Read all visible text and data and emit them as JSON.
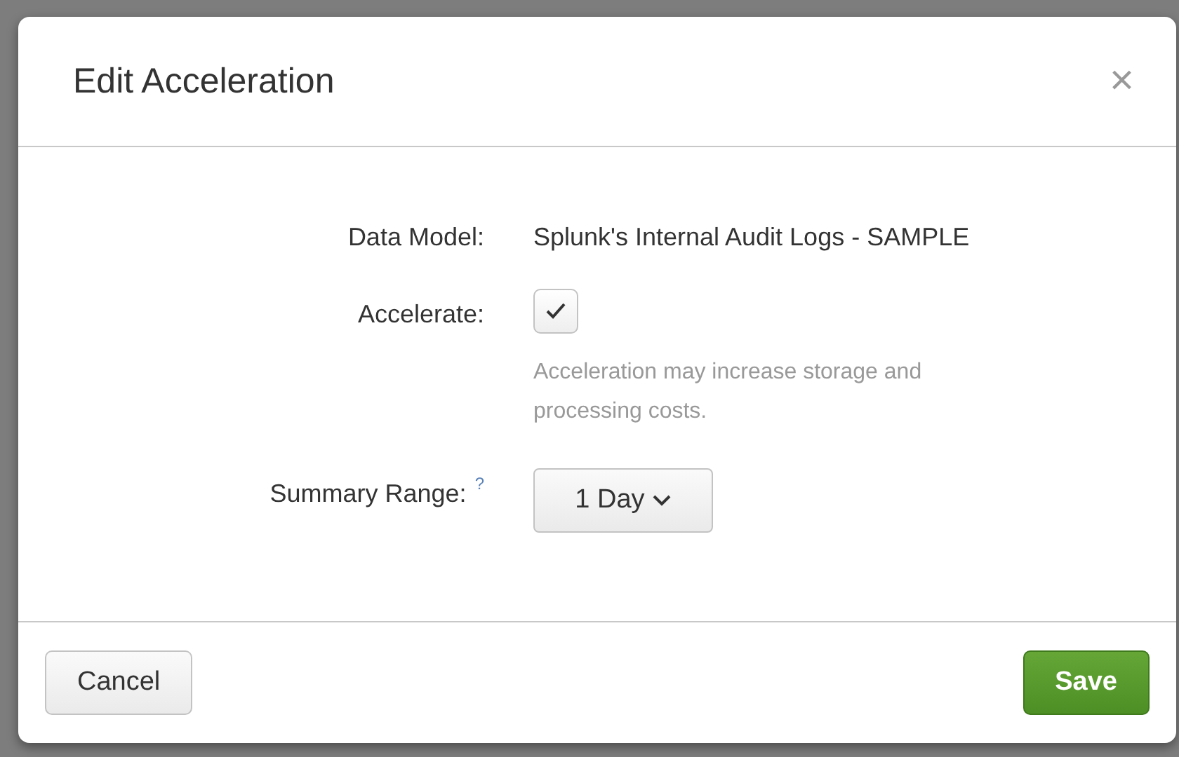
{
  "dialog": {
    "title": "Edit Acceleration",
    "close": "×"
  },
  "fields": [
    {
      "kind": "text",
      "label": "Data Model:",
      "value": "Splunk's Internal Audit Logs - SAMPLE"
    },
    {
      "kind": "checkbox",
      "label": "Accelerate:",
      "checked": true,
      "help": "Acceleration may increase storage and processing costs."
    },
    {
      "kind": "select",
      "label": "Summary Range:",
      "hint": "?",
      "value": "1 Day"
    }
  ],
  "buttons": [
    {
      "label": "Cancel",
      "kind": "secondary"
    },
    {
      "label": "Save",
      "kind": "primary"
    }
  ]
}
